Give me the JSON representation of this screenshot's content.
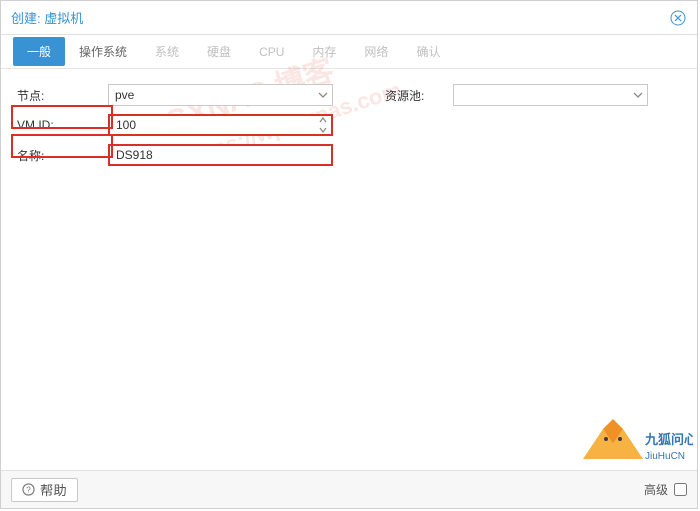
{
  "dialog": {
    "title": "创建: 虚拟机"
  },
  "tabs": {
    "general": "一般",
    "os": "操作系统",
    "system": "系统",
    "disk": "硬盘",
    "cpu": "CPU",
    "memory": "内存",
    "network": "网络",
    "confirm": "确认"
  },
  "form": {
    "node_label": "节点:",
    "node_value": "pve",
    "vmid_label": "VM ID:",
    "vmid_value": "100",
    "name_label": "名称:",
    "name_value": "DS918",
    "pool_label": "资源池:",
    "pool_value": ""
  },
  "footer": {
    "help": "帮助",
    "advanced": "高级"
  },
  "watermark": {
    "line1": "GXNAS 博客",
    "line2": "https://wp.gxnas.com",
    "logo_top": "九狐问心",
    "logo_bottom": "JiuHuCN"
  }
}
